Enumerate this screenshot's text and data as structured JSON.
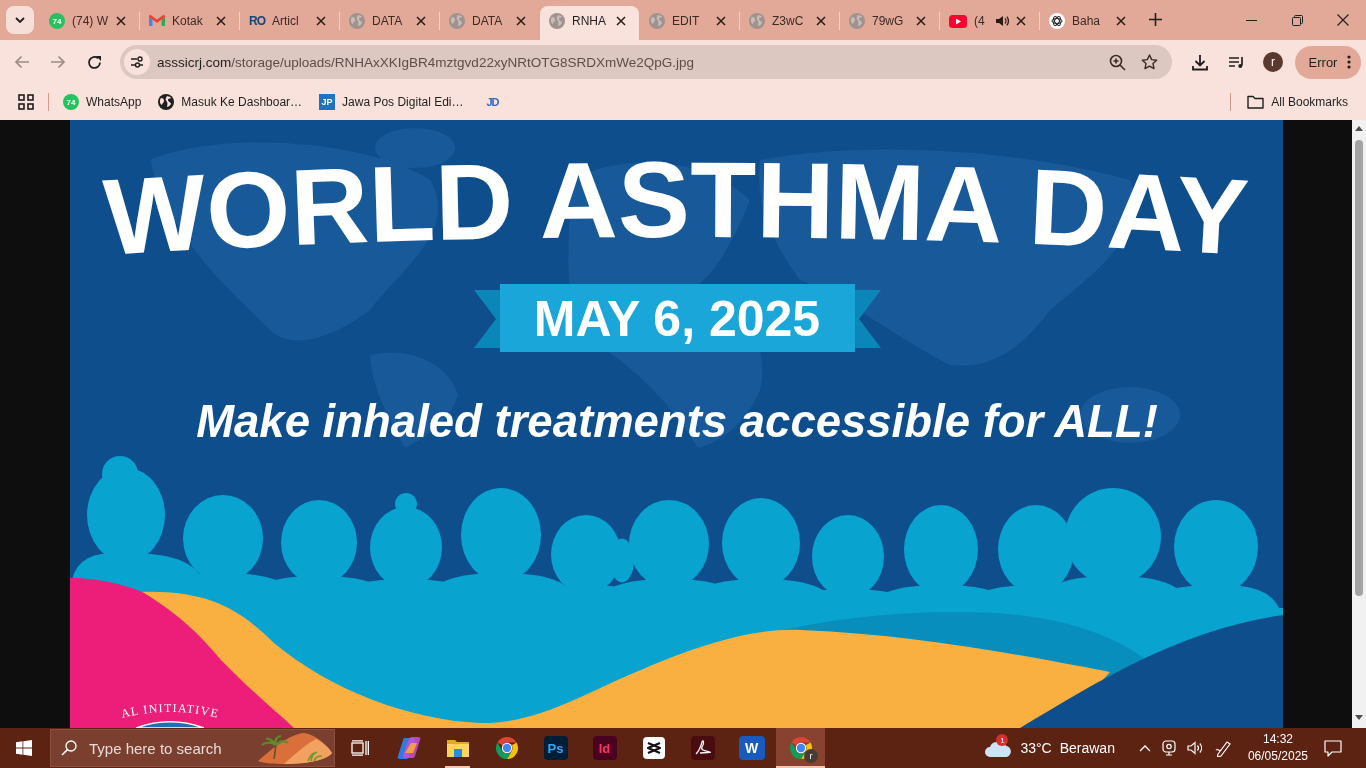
{
  "tab_strip": {
    "tabs": [
      {
        "title": "(74) W",
        "badge": "74",
        "selected": false,
        "audio": false
      },
      {
        "title": "Kotak",
        "selected": false,
        "audio": false
      },
      {
        "title": "Articl",
        "logo_text": "RO",
        "selected": false,
        "audio": false
      },
      {
        "title": "DATA",
        "selected": false,
        "audio": false
      },
      {
        "title": "DATA",
        "selected": false,
        "audio": false
      },
      {
        "title": "RNHA",
        "selected": true,
        "audio": false
      },
      {
        "title": "EDIT",
        "selected": false,
        "audio": false
      },
      {
        "title": "Z3wC",
        "selected": false,
        "audio": false
      },
      {
        "title": "79wG",
        "selected": false,
        "audio": false
      },
      {
        "title": "(4",
        "selected": false,
        "audio": true
      },
      {
        "title": "Baha",
        "selected": false,
        "audio": false
      }
    ]
  },
  "toolbar": {
    "back_disabled": true,
    "forward_disabled": true,
    "url": {
      "domain": "asssicrj.com",
      "path": "/storage/uploads/RNHAxXKIgBR4mztgvd22xyNRtOTG8SRDXmWe2QpG.jpg"
    },
    "profile_initial": "r",
    "status_label": "Error"
  },
  "bookmarks_bar": {
    "items": [
      {
        "label": "WhatsApp",
        "badge": "74"
      },
      {
        "label": "Masuk Ke Dashboar…"
      },
      {
        "label": "Jawa Pos Digital Edi…",
        "logo_text": "JP"
      },
      {
        "logo_text": "JD"
      }
    ],
    "all_bookmarks": "All Bookmarks"
  },
  "poster": {
    "title": "WORLD ASTHMA DAY",
    "date": "MAY 6, 2025",
    "tagline": "Make inhaled treatments accessible for ALL!",
    "logo_text": "AL INITIATIVE"
  },
  "taskbar": {
    "search_placeholder": "Type here to search",
    "apps": [
      {
        "selected": false,
        "running": false
      },
      {
        "selected": false,
        "running": false
      },
      {
        "selected": false,
        "running": true
      },
      {
        "selected": false,
        "running": false
      },
      {
        "logo_text": "Ps",
        "selected": false,
        "running": false
      },
      {
        "logo_text": "Id",
        "selected": false,
        "running": false
      },
      {
        "selected": false,
        "running": false
      },
      {
        "selected": false,
        "running": false
      },
      {
        "logo_text": "W",
        "selected": false,
        "running": false
      },
      {
        "badge": "r",
        "selected": true,
        "running": true
      }
    ],
    "weather": {
      "badge": "1",
      "temperature": "33°C",
      "condition": "Berawan"
    },
    "clock": {
      "time": "14:32",
      "date": "06/05/2025"
    }
  }
}
